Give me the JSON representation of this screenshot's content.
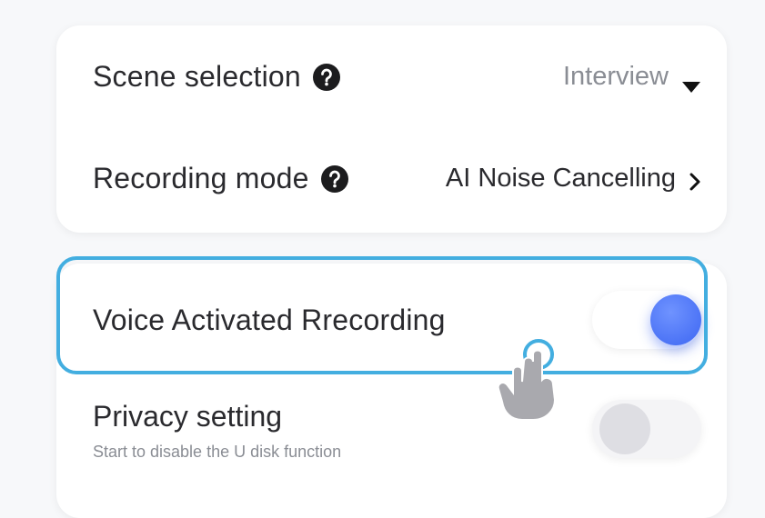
{
  "settings": {
    "scene": {
      "label": "Scene selection",
      "value": "Interview",
      "help_icon": "question-circle-icon",
      "dropdown_icon": "caret-down-icon"
    },
    "recording_mode": {
      "label": "Recording mode",
      "value": "AI Noise Cancelling",
      "help_icon": "question-circle-icon",
      "chevron_icon": "chevron-right-icon"
    },
    "voice_activated": {
      "label": "Voice Activated Rrecording",
      "enabled": true
    },
    "privacy": {
      "label": "Privacy setting",
      "description": "Start to disable the U disk function",
      "enabled": false
    }
  },
  "colors": {
    "highlight": "#43aee0",
    "toggle_on": "#3d66f2",
    "toggle_off": "#dedee3"
  },
  "overlay": {
    "pointer_icon": "tap-hand-icon"
  }
}
